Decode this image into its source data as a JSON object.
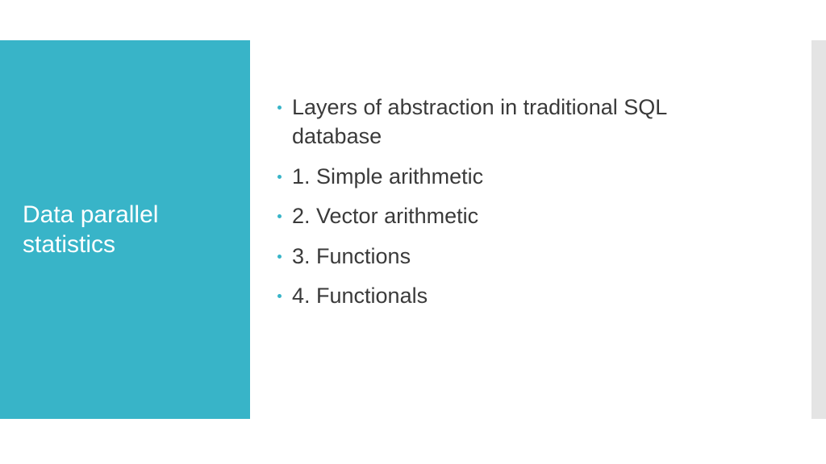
{
  "sidebar": {
    "title": "Data parallel statistics"
  },
  "content": {
    "items": [
      "Layers of abstraction in traditional SQL database",
      "1. Simple arithmetic",
      "2. Vector arithmetic",
      "3. Functions",
      "4. Functionals"
    ]
  },
  "colors": {
    "accent": "#38b4c8",
    "text": "#3a3a3a",
    "sidebar_text": "#ffffff"
  }
}
